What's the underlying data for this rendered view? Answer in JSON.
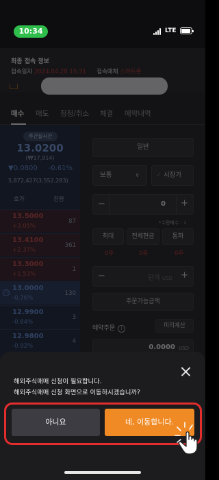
{
  "status_bar": {
    "time": "10:34",
    "network": "LTE"
  },
  "access_info": {
    "title": "최종 접속 정보",
    "time_label": "접속일자",
    "time_value": "2024.04.20 15:31",
    "media_label": "접속매체",
    "media_value": "스마트폰"
  },
  "tabs": [
    {
      "label": "매수"
    },
    {
      "label": "매도"
    },
    {
      "label": "정정/취소"
    },
    {
      "label": "체결"
    },
    {
      "label": "예약내역"
    }
  ],
  "quote": {
    "badge": "주간실시간",
    "price": "13.0200",
    "price_krw": "(₩17,914)",
    "change": "▼0.0800",
    "change_pct": "-0.61%",
    "volume": "5,872,427(3,552,283)",
    "col_price": "호가",
    "col_qty": "잔량"
  },
  "orderbook": [
    {
      "price": "13.5000",
      "rate": "+3.05%",
      "qty": "87",
      "dir": "up"
    },
    {
      "price": "13.4100",
      "rate": "+2.37%",
      "qty": "361",
      "dir": "up"
    },
    {
      "price": "13.3000",
      "rate": "+1.53%",
      "qty": "1",
      "dir": "up"
    },
    {
      "price": "13.0000",
      "rate": "-0.76%",
      "qty": "130",
      "dir": "down"
    },
    {
      "price": "12.9900",
      "rate": "-0.84%",
      "qty": "3",
      "dir": "down"
    },
    {
      "price": "12.9800",
      "rate": "-0.92%",
      "qty": "4",
      "dir": "down"
    }
  ],
  "order_form": {
    "general": "일반",
    "order_type": "보통",
    "market_price": "시장가",
    "qty_value": "0",
    "min_qty_note": "*수량배수 : 1",
    "opt_max": "최대",
    "opt_cash": "전체현금",
    "opt_fx": "통화",
    "opt_zero_1": "0주",
    "opt_zero_2": "0주",
    "opt_zero_3": "0주",
    "price_placeholder": "단가",
    "price_unit": "USD",
    "available": "주문가능금액",
    "reserve_label": "예약주문",
    "pre_calc": "미리계산",
    "amount": "0.0000",
    "amount_unit": "USD"
  },
  "dialog": {
    "line1": "해외주식매매 신청이 필요합니다.",
    "line2": "해외주식매매 신청 화면으로 이동하시겠습니까?",
    "no_label": "아니요",
    "yes_label": "네, 이동합니다."
  },
  "colors": {
    "accent": "#f08a24",
    "highlight": "#e52d2d",
    "up": "#b24a4a",
    "down": "#5f80c0"
  }
}
